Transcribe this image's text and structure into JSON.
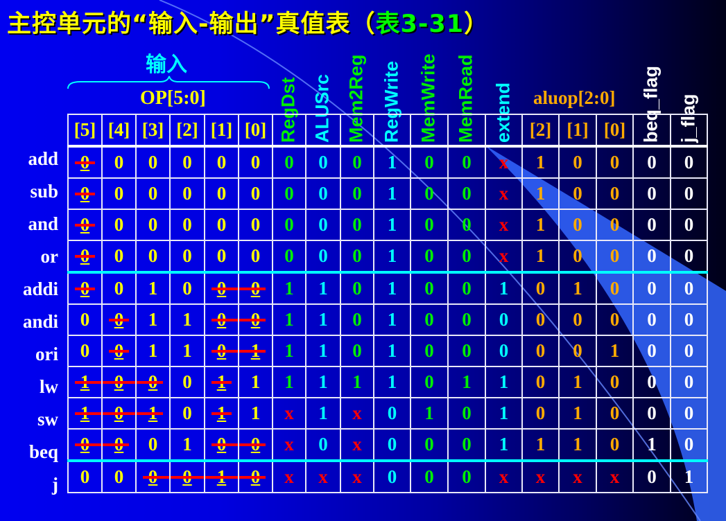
{
  "title": {
    "main": "主控单元的“输入-输出”真值表（",
    "ref": "表3-31",
    "close": "）"
  },
  "input_label": "输入",
  "op_label": "OP[5:0]",
  "aluop_label": "aluop[2:0]",
  "op_bits": [
    "[5]",
    "[4]",
    "[3]",
    "[2]",
    "[1]",
    "[0]"
  ],
  "outputs": [
    {
      "label": "RegDst",
      "color": "#00ee00"
    },
    {
      "label": "ALUSrc",
      "color": "#00ffff"
    },
    {
      "label": "Mem2Reg",
      "color": "#00ee00"
    },
    {
      "label": "RegWrite",
      "color": "#00ffff"
    },
    {
      "label": "MemWrite",
      "color": "#00ee00"
    },
    {
      "label": "MemRead",
      "color": "#00ee00"
    },
    {
      "label": "extend",
      "color": "#00ffff"
    }
  ],
  "aluop_bits": [
    "[2]",
    "[1]",
    "[0]"
  ],
  "flags": [
    "beq_flag",
    "j_flag"
  ],
  "colors": {
    "op": "#ffff00",
    "aluop": "#ffaa00",
    "flag": "#ffffff",
    "x": "#ff0000",
    "strike": "#ff0000"
  },
  "rows": [
    {
      "name": "add",
      "op": [
        "0",
        "0",
        "0",
        "0",
        "0",
        "0"
      ],
      "struck": [
        5
      ],
      "out": [
        "0",
        "0",
        "0",
        "1",
        "0",
        "0",
        "x"
      ],
      "aluop": [
        "1",
        "0",
        "0"
      ],
      "flags": [
        "0",
        "0"
      ]
    },
    {
      "name": "sub",
      "op": [
        "0",
        "0",
        "0",
        "0",
        "0",
        "0"
      ],
      "struck": [
        5
      ],
      "out": [
        "0",
        "0",
        "0",
        "1",
        "0",
        "0",
        "x"
      ],
      "aluop": [
        "1",
        "0",
        "0"
      ],
      "flags": [
        "0",
        "0"
      ]
    },
    {
      "name": "and",
      "op": [
        "0",
        "0",
        "0",
        "0",
        "0",
        "0"
      ],
      "struck": [
        5
      ],
      "out": [
        "0",
        "0",
        "0",
        "1",
        "0",
        "0",
        "x"
      ],
      "aluop": [
        "1",
        "0",
        "0"
      ],
      "flags": [
        "0",
        "0"
      ]
    },
    {
      "name": "or",
      "op": [
        "0",
        "0",
        "0",
        "0",
        "0",
        "0"
      ],
      "struck": [
        5
      ],
      "out": [
        "0",
        "0",
        "0",
        "1",
        "0",
        "0",
        "x"
      ],
      "aluop": [
        "1",
        "0",
        "0"
      ],
      "flags": [
        "0",
        "0"
      ]
    },
    {
      "name": "addi",
      "op": [
        "0",
        "0",
        "1",
        "0",
        "0",
        "0"
      ],
      "struck": [
        0,
        1,
        5
      ],
      "out": [
        "1",
        "1",
        "0",
        "1",
        "0",
        "0",
        "1"
      ],
      "aluop": [
        "0",
        "1",
        "0"
      ],
      "flags": [
        "0",
        "0"
      ]
    },
    {
      "name": "andi",
      "op": [
        "0",
        "0",
        "1",
        "1",
        "0",
        "0"
      ],
      "struck": [
        0,
        1,
        4
      ],
      "out": [
        "1",
        "1",
        "0",
        "1",
        "0",
        "0",
        "0"
      ],
      "aluop": [
        "0",
        "0",
        "0"
      ],
      "flags": [
        "0",
        "0"
      ]
    },
    {
      "name": "ori",
      "op": [
        "0",
        "0",
        "1",
        "1",
        "0",
        "1"
      ],
      "struck": [
        0,
        1,
        4
      ],
      "out": [
        "1",
        "1",
        "0",
        "1",
        "0",
        "0",
        "0"
      ],
      "aluop": [
        "0",
        "0",
        "1"
      ],
      "flags": [
        "0",
        "0"
      ]
    },
    {
      "name": "lw",
      "op": [
        "1",
        "0",
        "0",
        "0",
        "1",
        "1"
      ],
      "struck": [
        1,
        3,
        4,
        5
      ],
      "out": [
        "1",
        "1",
        "1",
        "1",
        "0",
        "1",
        "1"
      ],
      "aluop": [
        "0",
        "1",
        "0"
      ],
      "flags": [
        "0",
        "0"
      ]
    },
    {
      "name": "sw",
      "op": [
        "1",
        "0",
        "1",
        "0",
        "1",
        "1"
      ],
      "struck": [
        1,
        3,
        4,
        5
      ],
      "out": [
        "x",
        "1",
        "x",
        "0",
        "1",
        "0",
        "1"
      ],
      "aluop": [
        "0",
        "1",
        "0"
      ],
      "flags": [
        "0",
        "0"
      ]
    },
    {
      "name": "beq",
      "op": [
        "0",
        "0",
        "0",
        "1",
        "0",
        "0"
      ],
      "struck": [
        0,
        1,
        4,
        5
      ],
      "out": [
        "x",
        "0",
        "x",
        "0",
        "0",
        "0",
        "1"
      ],
      "aluop": [
        "1",
        "1",
        "0"
      ],
      "flags": [
        "1",
        "0"
      ]
    },
    {
      "name": "j",
      "op": [
        "0",
        "0",
        "0",
        "0",
        "1",
        "0"
      ],
      "struck": [
        0,
        1,
        2,
        3
      ],
      "out": [
        "x",
        "x",
        "x",
        "0",
        "0",
        "0",
        "x"
      ],
      "aluop": [
        "x",
        "x",
        "x"
      ],
      "flags": [
        "0",
        "1"
      ]
    }
  ]
}
